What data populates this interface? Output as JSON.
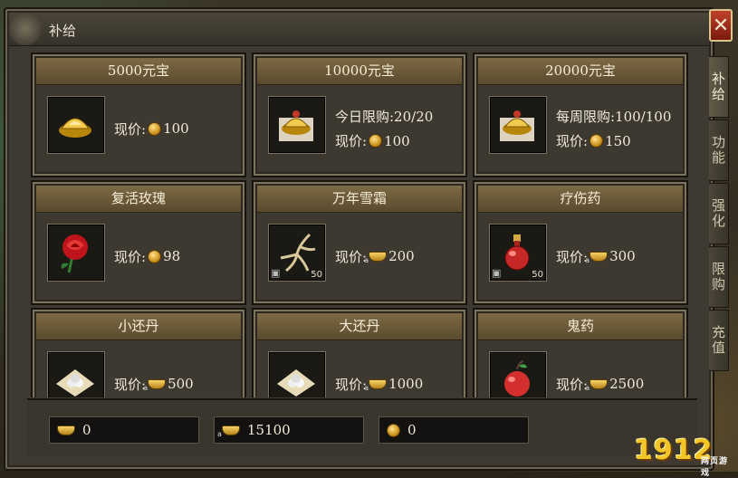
{
  "window": {
    "title": "补给",
    "close_label": "✕"
  },
  "side_tabs": [
    {
      "label": "补给",
      "active": true
    },
    {
      "label": "功能",
      "active": false
    },
    {
      "label": "强化",
      "active": false
    },
    {
      "label": "限购",
      "active": false
    },
    {
      "label": "充值",
      "active": false
    }
  ],
  "price_label": "现价:",
  "items": [
    {
      "name": "5000元宝",
      "icon": "gold-ingot-pile-icon",
      "limit": "",
      "currency": "coin",
      "price": "100"
    },
    {
      "name": "10000元宝",
      "icon": "gold-ingot-pile-icon",
      "limit": "今日限购:20/20",
      "currency": "coin",
      "price": "100"
    },
    {
      "name": "20000元宝",
      "icon": "gold-ingot-pile-icon",
      "limit": "每周限购:100/100",
      "currency": "coin",
      "price": "150"
    },
    {
      "name": "复活玫瑰",
      "icon": "red-rose-icon",
      "limit": "",
      "currency": "coin",
      "price": "98"
    },
    {
      "name": "万年雪霜",
      "icon": "ginseng-root-icon",
      "limit": "",
      "currency": "bound-ingot",
      "price": "200",
      "count": "50",
      "locked": true
    },
    {
      "name": "疗伤药",
      "icon": "red-potion-icon",
      "limit": "",
      "currency": "bound-ingot",
      "price": "300",
      "count": "50",
      "locked": true
    },
    {
      "name": "小还丹",
      "icon": "pill-bag-icon",
      "limit": "",
      "currency": "bound-ingot",
      "price": "500"
    },
    {
      "name": "大还丹",
      "icon": "pill-bag-icon",
      "limit": "",
      "currency": "bound-ingot",
      "price": "1000"
    },
    {
      "name": "鬼药",
      "icon": "red-apple-icon",
      "limit": "",
      "currency": "bound-ingot",
      "price": "2500"
    }
  ],
  "balances": [
    {
      "icon": "ingot-icon",
      "value": "0"
    },
    {
      "icon": "bound-ingot-icon",
      "value": "15100"
    },
    {
      "icon": "coin-icon",
      "value": "0"
    }
  ],
  "logo": {
    "text": "1912",
    "sub": "网页游戏"
  }
}
